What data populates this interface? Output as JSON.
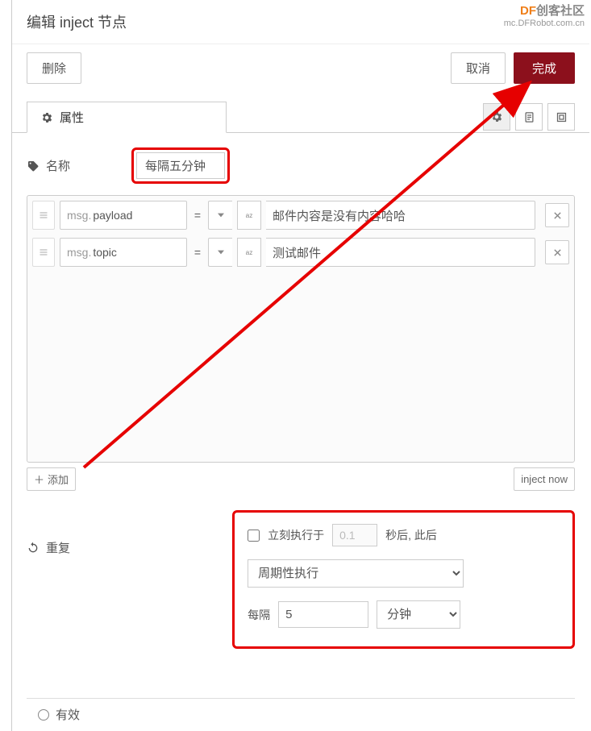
{
  "watermark": {
    "brand_prefix": "DF",
    "brand_rest": "创客社区",
    "url": "mc.DFRobot.com.cn"
  },
  "header": {
    "title": "编辑 inject 节点"
  },
  "actions": {
    "delete": "删除",
    "cancel": "取消",
    "done": "完成"
  },
  "tabs": {
    "properties": "属性"
  },
  "form": {
    "name_label": "名称",
    "name_value": "每隔五分钟"
  },
  "props": {
    "msg_prefix": "msg.",
    "rows": [
      {
        "key": "payload",
        "value": "邮件内容是没有内容哈哈"
      },
      {
        "key": "topic",
        "value": "测试邮件"
      }
    ],
    "equals": "="
  },
  "buttons": {
    "add": "添加",
    "inject_now": "inject now"
  },
  "repeat": {
    "label": "重复",
    "once_label_before": "立刻执行于",
    "once_seconds": "0.1",
    "once_label_after": "秒后, 此后",
    "mode": "周期性执行",
    "every_label": "每隔",
    "every_value": "5",
    "every_unit": "分钟"
  },
  "footer": {
    "enabled": "有效"
  },
  "colors": {
    "primary": "#8c101c",
    "highlight": "#e60000"
  }
}
